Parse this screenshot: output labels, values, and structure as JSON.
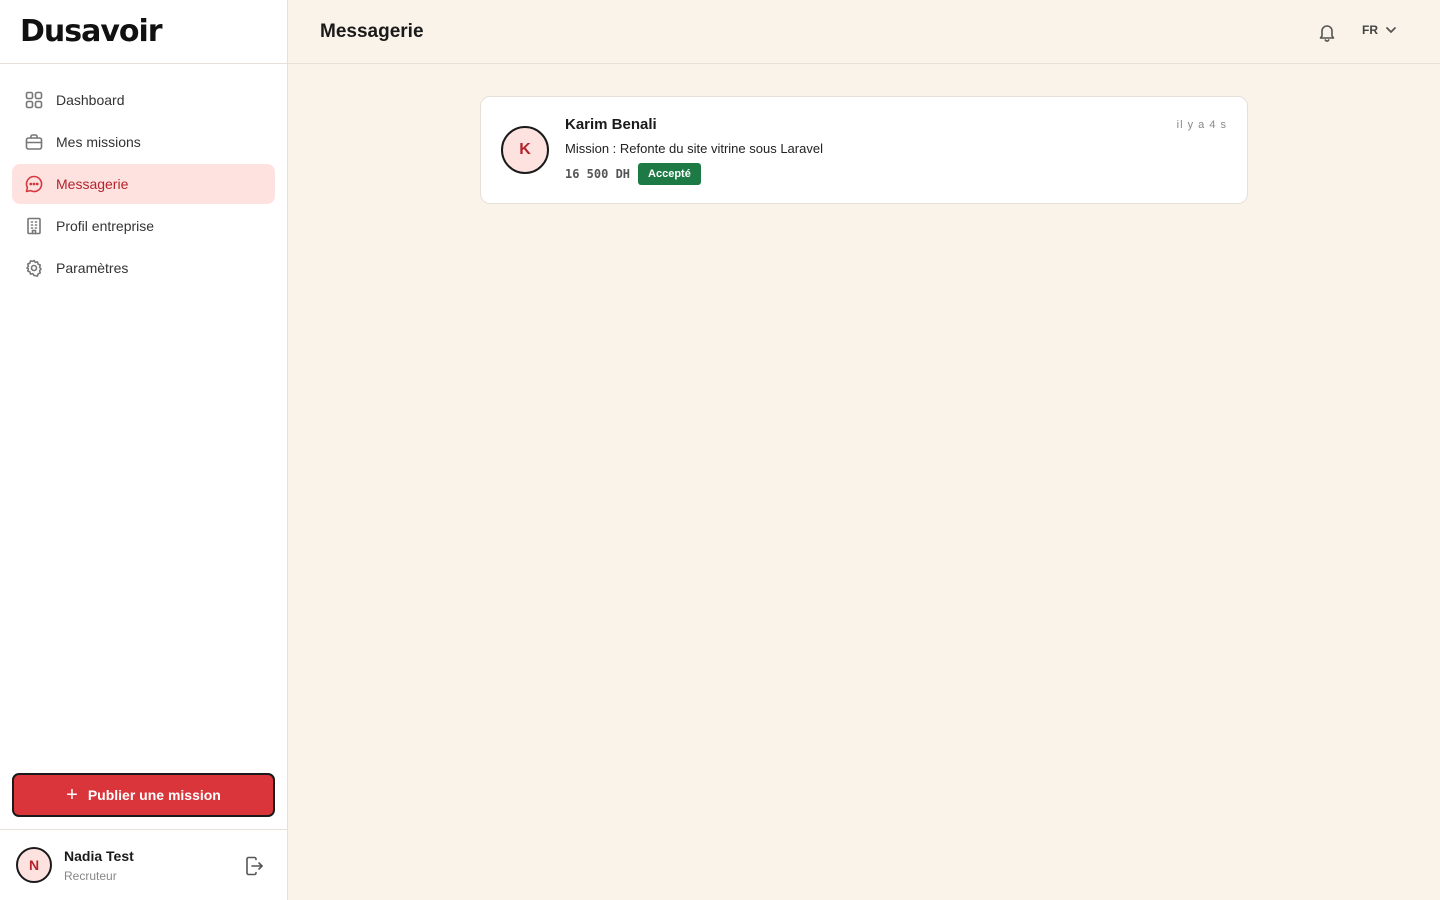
{
  "brand": {
    "logo": "Dusavoir"
  },
  "sidebar": {
    "items": [
      {
        "label": "Dashboard",
        "icon": "grid-icon"
      },
      {
        "label": "Mes missions",
        "icon": "briefcase-icon"
      },
      {
        "label": "Messagerie",
        "icon": "chat-icon",
        "active": true
      },
      {
        "label": "Profil entreprise",
        "icon": "building-icon"
      },
      {
        "label": "Paramètres",
        "icon": "gear-icon"
      }
    ],
    "publish_label": "Publier une mission"
  },
  "user": {
    "initial": "N",
    "name": "Nadia Test",
    "role": "Recruteur"
  },
  "header": {
    "title": "Messagerie",
    "language": "FR"
  },
  "conversations": [
    {
      "initial": "K",
      "name": "Karim Benali",
      "time": "il y a 4 s",
      "mission": "Mission : Refonte du site vitrine sous Laravel",
      "price": "16 500 DH",
      "status": "Accepté"
    }
  ],
  "colors": {
    "accent": "#d9353b",
    "active_bg": "#fde2e0",
    "success": "#1e7a45",
    "background": "#faf3ea"
  }
}
